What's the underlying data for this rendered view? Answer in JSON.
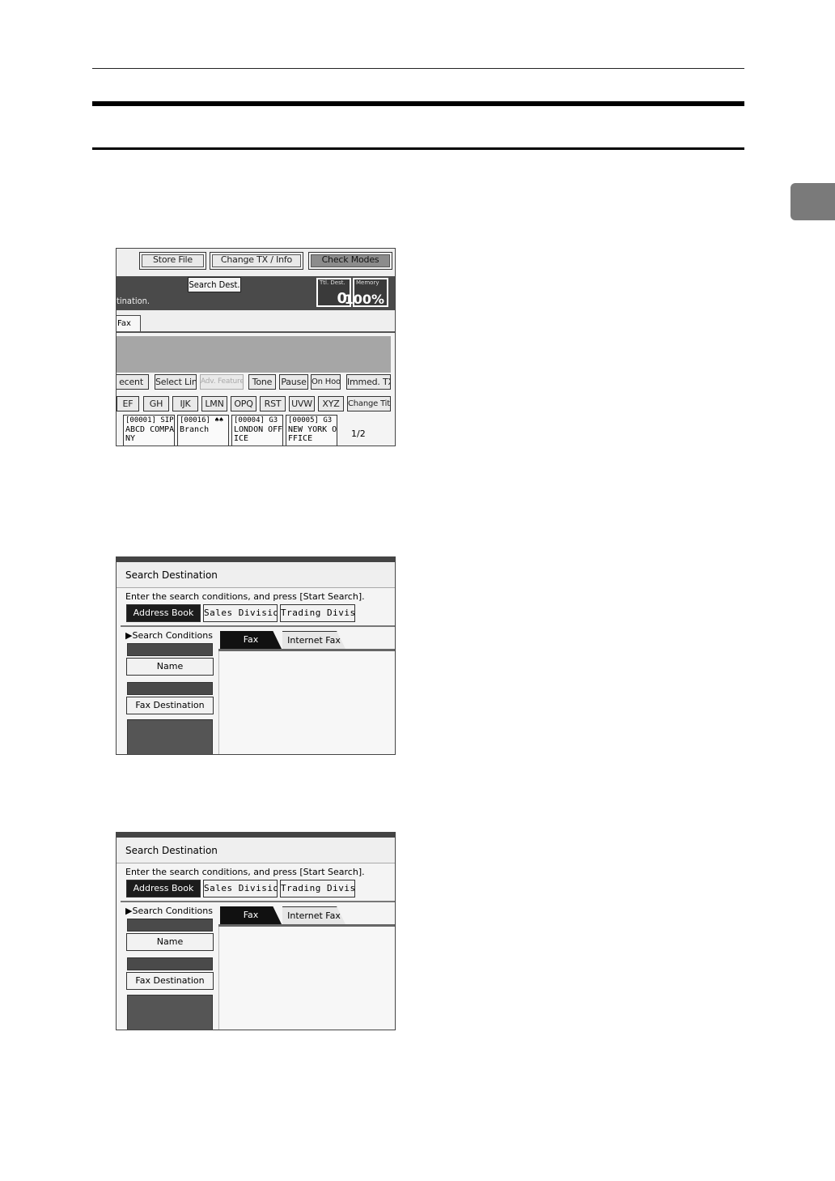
{
  "page": {
    "side_tab_label": ""
  },
  "screen1": {
    "buttons_top": {
      "store_file": "Store File",
      "change_tx_info": "Change TX / Info",
      "check_modes": "Check Modes"
    },
    "search_dest": "Search Dest.",
    "instruction_fragment": "tination.",
    "ttl_dest_label": "Ttl. Dest.",
    "ttl_dest_value": "0",
    "memory_label": "Memory",
    "memory_value": "100%",
    "tab_fax": "Fax",
    "row1": {
      "recent": "ecent",
      "select_line": "Select Line",
      "adv_features": "Adv. Features",
      "tone": "Tone",
      "pause": "Pause",
      "on_hook": "On Hook",
      "immed_tx": "Immed. TX"
    },
    "index_keys": [
      "EF",
      "GH",
      "IJK",
      "LMN",
      "OPQ",
      "RST",
      "UVW",
      "XYZ"
    ],
    "change_title": "Change Title",
    "entries": [
      {
        "header": "[00001] SIP",
        "line1": "ABCD COMPA",
        "line2": "NY"
      },
      {
        "header": "[00016] ♠♠",
        "line1": "Branch",
        "line2": ""
      },
      {
        "header": "[00004] G3",
        "line1": "LONDON OFF",
        "line2": "ICE"
      },
      {
        "header": "[00005] G3",
        "line1": "NEW YORK O",
        "line2": "FFICE"
      }
    ],
    "pager": "1/2"
  },
  "search_screen": {
    "title": "Search Destination",
    "instruction": "Enter the search conditions, and press [Start Search].",
    "address_book": "Address Book",
    "sales_division": "Sales Division",
    "trading_division": "Trading Divisi..",
    "search_conditions": "▶Search Conditions",
    "name_button": "Name",
    "fax_destination_button": "Fax Destination",
    "tab_fax": "Fax",
    "tab_internet_fax": "Internet Fax"
  }
}
